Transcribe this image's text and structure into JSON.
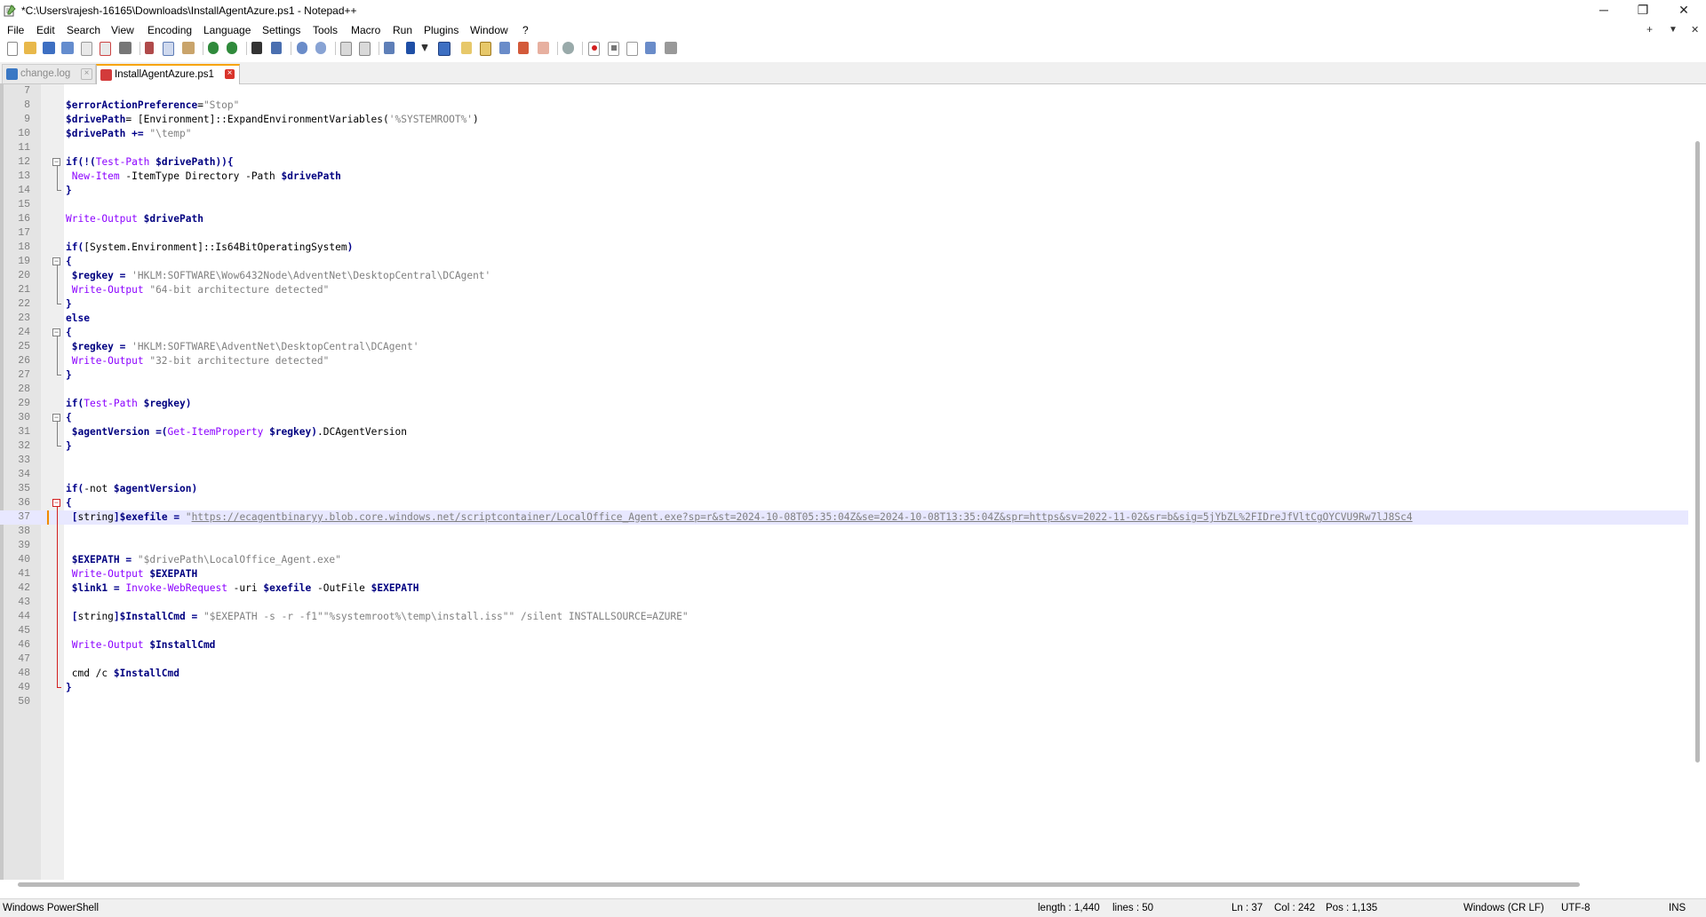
{
  "window": {
    "title": "*C:\\Users\\rajesh-16165\\Downloads\\InstallAgentAzure.ps1 - Notepad++",
    "minimize": "─",
    "maximize": "❐",
    "close": "✕"
  },
  "menu": {
    "items": [
      "File",
      "Edit",
      "Search",
      "View",
      "Encoding",
      "Language",
      "Settings",
      "Tools",
      "Macro",
      "Run",
      "Plugins",
      "Window",
      "?"
    ],
    "right": [
      "+",
      "▼",
      "✕"
    ]
  },
  "toolbar": {
    "icons": [
      "new-file-icon",
      "open-file-icon",
      "save-icon",
      "save-all-icon",
      "close-icon",
      "close-all-icon",
      "print-icon",
      "cut-icon",
      "copy-icon",
      "paste-icon",
      "undo-icon",
      "redo-icon",
      "find-icon",
      "replace-icon",
      "zoom-in-icon",
      "zoom-out-icon",
      "sync-vertical-icon",
      "sync-horizontal-icon",
      "word-wrap-icon",
      "show-all-chars-icon",
      "indent-guide-icon",
      "udl-icon",
      "doc-map-icon",
      "doc-list-icon",
      "function-list-icon",
      "folder-workspace-icon",
      "monitoring-icon",
      "record-macro-icon",
      "stop-macro-icon",
      "play-macro-icon",
      "run-macro-multiple-icon",
      "save-macro-icon"
    ]
  },
  "tabs": [
    {
      "label": "change.log",
      "active": false,
      "icon_color": "#3b78c4"
    },
    {
      "label": "InstallAgentAzure.ps1",
      "active": true,
      "icon_color": "#d33b3b"
    }
  ],
  "editor": {
    "current_line": 37,
    "lines": [
      {
        "n": "7",
        "segs": []
      },
      {
        "n": "8",
        "segs": [
          [
            "v",
            "$errorActionPreference"
          ],
          [
            "",
            "="
          ],
          [
            "s",
            "\"Stop\""
          ]
        ]
      },
      {
        "n": "9",
        "segs": [
          [
            "v",
            "$drivePath"
          ],
          [
            "",
            "= ["
          ],
          [
            "",
            "Environment"
          ],
          [
            "",
            "]::ExpandEnvironmentVariables("
          ],
          [
            "s",
            "'%SYSTEMROOT%'"
          ],
          [
            "",
            ")"
          ]
        ]
      },
      {
        "n": "10",
        "segs": [
          [
            "v",
            "$drivePath"
          ],
          [
            "",
            " "
          ],
          [
            "p",
            "+="
          ],
          [
            "",
            " "
          ],
          [
            "s",
            "\"\\temp\""
          ]
        ]
      },
      {
        "n": "11",
        "segs": []
      },
      {
        "n": "12",
        "segs": [
          [
            "k",
            "if"
          ],
          [
            "p",
            "(!("
          ],
          [
            "c",
            "Test-Path"
          ],
          [
            "",
            " "
          ],
          [
            "v",
            "$drivePath"
          ],
          [
            "p",
            "))"
          ],
          [
            "p",
            "{"
          ]
        ]
      },
      {
        "n": "13",
        "segs": [
          [
            "",
            " "
          ],
          [
            "c",
            "New-Item"
          ],
          [
            "",
            " -ItemType Directory -Path "
          ],
          [
            "v",
            "$drivePath"
          ]
        ]
      },
      {
        "n": "14",
        "segs": [
          [
            "p",
            "}"
          ]
        ]
      },
      {
        "n": "15",
        "segs": []
      },
      {
        "n": "16",
        "segs": [
          [
            "c",
            "Write-Output"
          ],
          [
            "",
            " "
          ],
          [
            "v",
            "$drivePath"
          ]
        ]
      },
      {
        "n": "17",
        "segs": []
      },
      {
        "n": "18",
        "segs": [
          [
            "k",
            "if"
          ],
          [
            "p",
            "("
          ],
          [
            "",
            "[System.Environment]::Is64BitOperatingSystem"
          ],
          [
            "p",
            ")"
          ]
        ]
      },
      {
        "n": "19",
        "segs": [
          [
            "p",
            "{"
          ]
        ]
      },
      {
        "n": "20",
        "segs": [
          [
            "",
            " "
          ],
          [
            "v",
            "$regkey"
          ],
          [
            "",
            " "
          ],
          [
            "p",
            "="
          ],
          [
            "",
            " "
          ],
          [
            "s",
            "'HKLM:SOFTWARE\\Wow6432Node\\AdventNet\\DesktopCentral\\DCAgent'"
          ]
        ]
      },
      {
        "n": "21",
        "segs": [
          [
            "",
            " "
          ],
          [
            "c",
            "Write-Output"
          ],
          [
            "",
            " "
          ],
          [
            "s",
            "\"64-bit architecture detected\""
          ]
        ]
      },
      {
        "n": "22",
        "segs": [
          [
            "p",
            "}"
          ]
        ]
      },
      {
        "n": "23",
        "segs": [
          [
            "k",
            "else"
          ]
        ]
      },
      {
        "n": "24",
        "segs": [
          [
            "p",
            "{"
          ]
        ]
      },
      {
        "n": "25",
        "segs": [
          [
            "",
            " "
          ],
          [
            "v",
            "$regkey"
          ],
          [
            "",
            " "
          ],
          [
            "p",
            "="
          ],
          [
            "",
            " "
          ],
          [
            "s",
            "'HKLM:SOFTWARE\\AdventNet\\DesktopCentral\\DCAgent'"
          ]
        ]
      },
      {
        "n": "26",
        "segs": [
          [
            "",
            " "
          ],
          [
            "c",
            "Write-Output"
          ],
          [
            "",
            " "
          ],
          [
            "s",
            "\"32-bit architecture detected\""
          ]
        ]
      },
      {
        "n": "27",
        "segs": [
          [
            "p",
            "}"
          ]
        ]
      },
      {
        "n": "28",
        "segs": []
      },
      {
        "n": "29",
        "segs": [
          [
            "k",
            "if"
          ],
          [
            "p",
            "("
          ],
          [
            "c",
            "Test-Path"
          ],
          [
            "",
            " "
          ],
          [
            "v",
            "$regkey"
          ],
          [
            "p",
            ")"
          ]
        ]
      },
      {
        "n": "30",
        "segs": [
          [
            "p",
            "{"
          ]
        ]
      },
      {
        "n": "31",
        "segs": [
          [
            "",
            " "
          ],
          [
            "v",
            "$agentVersion"
          ],
          [
            "",
            " "
          ],
          [
            "p",
            "=("
          ],
          [
            "c",
            "Get-ItemProperty"
          ],
          [
            "",
            " "
          ],
          [
            "v",
            "$regkey"
          ],
          [
            "p",
            ")"
          ],
          [
            "",
            ".DCAgentVersion"
          ]
        ]
      },
      {
        "n": "32",
        "segs": [
          [
            "p",
            "}"
          ]
        ]
      },
      {
        "n": "33",
        "segs": []
      },
      {
        "n": "34",
        "segs": []
      },
      {
        "n": "35",
        "segs": [
          [
            "k",
            "if"
          ],
          [
            "p",
            "("
          ],
          [
            "",
            "-not "
          ],
          [
            "v",
            "$agentVersion"
          ],
          [
            "p",
            ")"
          ]
        ]
      },
      {
        "n": "36",
        "segs": [
          [
            "p",
            "{"
          ]
        ]
      },
      {
        "n": "37",
        "segs": [
          [
            "",
            " "
          ],
          [
            "p",
            "["
          ],
          [
            "",
            "string"
          ],
          [
            "p",
            "]"
          ],
          [
            "v",
            "$exefile"
          ],
          [
            "",
            " "
          ],
          [
            "p",
            "="
          ],
          [
            "",
            " "
          ],
          [
            "s",
            "\""
          ],
          [
            "u",
            "https://ecagentbinaryy.blob.core.windows.net/scriptcontainer/LocalOffice_Agent.exe?sp=r&st=2024-10-08T05:35:04Z&se=2024-10-08T13:35:04Z&spr=https&sv=2022-11-02&sr=b&sig=5jYbZL%2FIDreJfVltCgOYCVU9Rw7lJ8Sc4"
          ]
        ]
      },
      {
        "n": "38",
        "segs": []
      },
      {
        "n": "39",
        "segs": []
      },
      {
        "n": "40",
        "segs": [
          [
            "",
            " "
          ],
          [
            "v",
            "$EXEPATH"
          ],
          [
            "",
            " "
          ],
          [
            "p",
            "="
          ],
          [
            "",
            " "
          ],
          [
            "s",
            "\"$drivePath\\LocalOffice_Agent.exe\""
          ]
        ]
      },
      {
        "n": "41",
        "segs": [
          [
            "",
            " "
          ],
          [
            "c",
            "Write-Output"
          ],
          [
            "",
            " "
          ],
          [
            "v",
            "$EXEPATH"
          ]
        ]
      },
      {
        "n": "42",
        "segs": [
          [
            "",
            " "
          ],
          [
            "v",
            "$link1"
          ],
          [
            "",
            " "
          ],
          [
            "p",
            "="
          ],
          [
            "",
            " "
          ],
          [
            "c",
            "Invoke-WebRequest"
          ],
          [
            "",
            " -uri "
          ],
          [
            "v",
            "$exefile"
          ],
          [
            "",
            " -OutFile "
          ],
          [
            "v",
            "$EXEPATH"
          ]
        ]
      },
      {
        "n": "43",
        "segs": []
      },
      {
        "n": "44",
        "segs": [
          [
            "",
            " "
          ],
          [
            "p",
            "["
          ],
          [
            "",
            "string"
          ],
          [
            "p",
            "]"
          ],
          [
            "v",
            "$InstallCmd"
          ],
          [
            "",
            " "
          ],
          [
            "p",
            "="
          ],
          [
            "",
            " "
          ],
          [
            "s",
            "\"$EXEPATH -s -r -f1\"\"%systemroot%\\temp\\install.iss\"\" /silent INSTALLSOURCE=AZURE\""
          ]
        ]
      },
      {
        "n": "45",
        "segs": []
      },
      {
        "n": "46",
        "segs": [
          [
            "",
            " "
          ],
          [
            "c",
            "Write-Output"
          ],
          [
            "",
            " "
          ],
          [
            "v",
            "$InstallCmd"
          ]
        ]
      },
      {
        "n": "47",
        "segs": []
      },
      {
        "n": "48",
        "segs": [
          [
            "",
            " cmd /c "
          ],
          [
            "v",
            "$InstallCmd"
          ]
        ]
      },
      {
        "n": "49",
        "segs": [
          [
            "p",
            "}"
          ]
        ]
      },
      {
        "n": "50",
        "segs": []
      }
    ]
  },
  "statusbar": {
    "language": "Windows PowerShell",
    "length": "length : 1,440",
    "lines": "lines : 50",
    "ln": "Ln : 37",
    "col": "Col : 242",
    "pos": "Pos : 1,135",
    "eol": "Windows (CR LF)",
    "encoding": "UTF-8",
    "mode": "INS"
  },
  "colors": {
    "keyword": "#00008b",
    "variable": "#000080",
    "cmdlet": "#8b00ff",
    "string": "#808080",
    "active_tab_accent": "#f7a400",
    "current_line_bg": "#e8e8ff"
  }
}
